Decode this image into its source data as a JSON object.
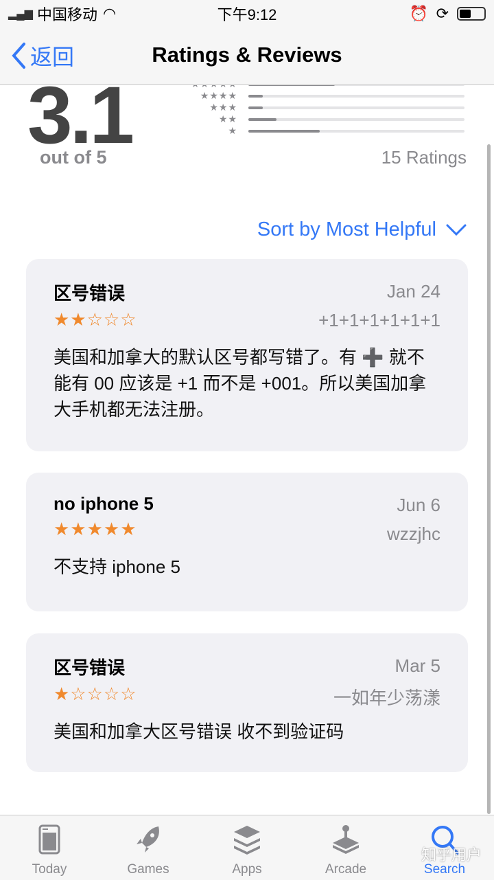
{
  "status": {
    "carrier": "中国移动",
    "time": "下午9:12"
  },
  "nav": {
    "back_label": "返回",
    "title": "Ratings & Reviews"
  },
  "summary": {
    "average": "3.1",
    "out_of": "out of 5",
    "count_label": "15 Ratings",
    "distribution": [
      {
        "stars": "★★★★★",
        "fraction": 0.4
      },
      {
        "stars": "★★★★",
        "fraction": 0.067
      },
      {
        "stars": "★★★",
        "fraction": 0.067
      },
      {
        "stars": "★★",
        "fraction": 0.13
      },
      {
        "stars": "★",
        "fraction": 0.33
      }
    ]
  },
  "sort_label": "Sort by Most Helpful",
  "reviews": [
    {
      "title": "区号错误",
      "date": "Jan 24",
      "author": "+1+1+1+1+1+1",
      "rating": 2,
      "stars": "★★☆☆☆",
      "body": "美国和加拿大的默认区号都写错了。有 ➕ 就不能有 00 应该是 +1 而不是 +001。所以美国加拿大手机都无法注册。"
    },
    {
      "title": "no iphone 5",
      "date": "Jun 6",
      "author": "wzzjhc",
      "rating": 5,
      "stars": "★★★★★",
      "body": "不支持 iphone 5"
    },
    {
      "title": "区号错误",
      "date": "Mar 5",
      "author": "一如年少荡漾",
      "rating": 1,
      "stars": "★☆☆☆☆",
      "body": "美国和加拿大区号错误  收不到验证码"
    }
  ],
  "tabs": [
    {
      "label": "Today",
      "icon": "today-icon"
    },
    {
      "label": "Games",
      "icon": "rocket-icon"
    },
    {
      "label": "Apps",
      "icon": "apps-stack-icon"
    },
    {
      "label": "Arcade",
      "icon": "joystick-icon"
    },
    {
      "label": "Search",
      "icon": "search-icon",
      "active": true
    }
  ],
  "watermark": "知乎用户",
  "colors": {
    "accent": "#3478f6",
    "star": "#f0892d"
  }
}
